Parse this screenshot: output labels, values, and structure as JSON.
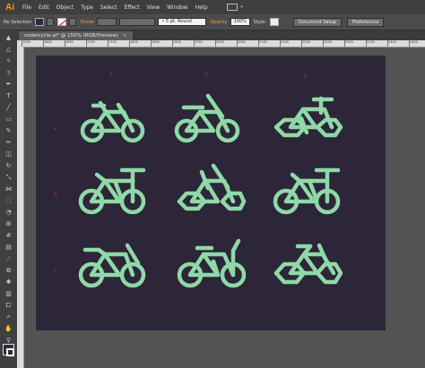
{
  "app": {
    "logo": "Ai",
    "menus": [
      "File",
      "Edit",
      "Object",
      "Type",
      "Select",
      "Effect",
      "View",
      "Window",
      "Help"
    ],
    "workspace_icon": "arrange-documents-icon"
  },
  "control_bar": {
    "selection": "No Selection",
    "stroke_label": "Stroke",
    "brush": "5 pt. Round",
    "opacity_label": "Opacity",
    "opacity_value": "100%",
    "style_label": "Style:",
    "doc_setup": "Document Setup",
    "preferences": "Preferences"
  },
  "document": {
    "tab_title": "codercycle.ai* @ 150% (RGB/Preview)",
    "close": "×"
  },
  "ruler_ticks": [
    "1550",
    "1600",
    "1650",
    "1700",
    "1750",
    "1800",
    "1850",
    "1900",
    "1950",
    "2000",
    "2050",
    "2100",
    "2150",
    "2200",
    "2250",
    "2300",
    "2350",
    "2400",
    "2450"
  ],
  "artboard": {
    "background": "#2c2638",
    "icon_color": "#8fd9a8",
    "label_color": "#9e3848",
    "column_labels": [
      "1",
      "2",
      "3"
    ],
    "row_labels": [
      "a",
      "b",
      "c"
    ],
    "icons": [
      "bicycle-1a-icon",
      "bicycle-2a-icon",
      "bicycle-3a-icon",
      "bicycle-1b-icon",
      "bicycle-2b-icon",
      "bicycle-3b-icon",
      "bicycle-1c-icon",
      "bicycle-2c-icon",
      "bicycle-3c-icon"
    ]
  }
}
